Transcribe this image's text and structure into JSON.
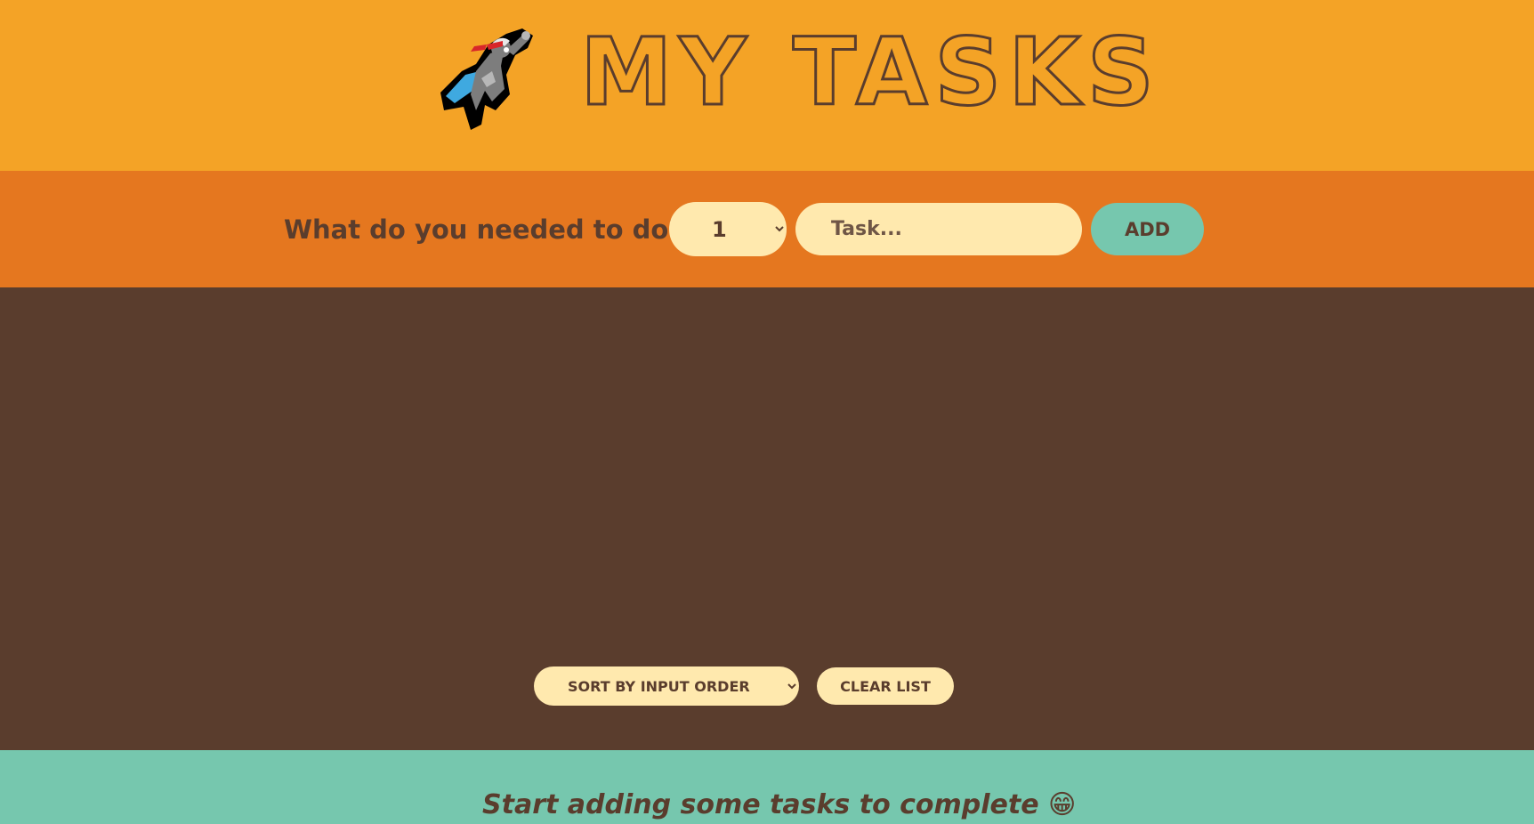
{
  "header": {
    "logo_icon": "superhero-icon",
    "title": "MY TASKS"
  },
  "input_bar": {
    "prompt": "What do you needed to do?",
    "priority_selected": "1",
    "task_placeholder": "Task...",
    "add_label": "ADD"
  },
  "list": {
    "sort_selected": "SORT BY INPUT ORDER",
    "clear_label": "CLEAR LIST"
  },
  "footer": {
    "message": "Start adding some tasks to complete 😁"
  },
  "colors": {
    "header_bg": "#f4a326",
    "input_bar_bg": "#e5771f",
    "list_bg": "#5a3d2d",
    "footer_bg": "#76c7ae",
    "control_bg": "#ffe9ae",
    "text": "#5a3d2d"
  }
}
